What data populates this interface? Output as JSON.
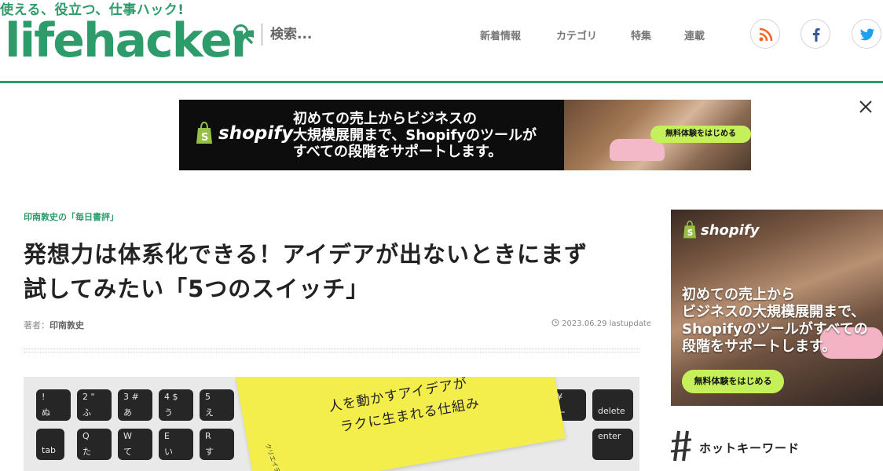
{
  "colors": {
    "brand": "#2e9b6b",
    "cta": "#c6f05a"
  },
  "header": {
    "tagline": "使える、役立つ、仕事ハック!",
    "logo_part1": "life",
    "logo_part2": "hacker",
    "search_placeholder": "検索...",
    "nav": [
      "新着情報",
      "カテゴリ",
      "特集",
      "連載"
    ],
    "social": [
      "rss-icon",
      "facebook-icon",
      "twitter-icon"
    ]
  },
  "top_ad": {
    "brand": "shopify",
    "line1": "初めての売上からビジネスの",
    "line2": "大規模展開まで、Shopifyのツールが",
    "line3": "すべての段階をサポートします。",
    "cta": "無料体験をはじめる"
  },
  "article": {
    "category": "印南敦史の「毎日書評」",
    "title_line1": "発想力は体系化できる！アイデアが出ないときにまず",
    "title_line2": "試してみたい「5つのスイッチ」",
    "author_label": "著者：",
    "author_name": "印南敦史",
    "date": "2023.06.29 lastupdate",
    "hero_card": {
      "line1": "人を動かすアイデアが",
      "line2": "ラクに生まれる仕組み",
      "side": "クリエイティブ"
    }
  },
  "side_ad": {
    "brand": "shopify",
    "line1": "初めての売上から",
    "line2": "ビジネスの大規模展開まで、",
    "line3": "Shopifyのツールがすべての",
    "line4": "段階をサポートします。",
    "cta": "無料体験をはじめる"
  },
  "sidebar": {
    "hot_keywords": "ホットキーワード"
  }
}
